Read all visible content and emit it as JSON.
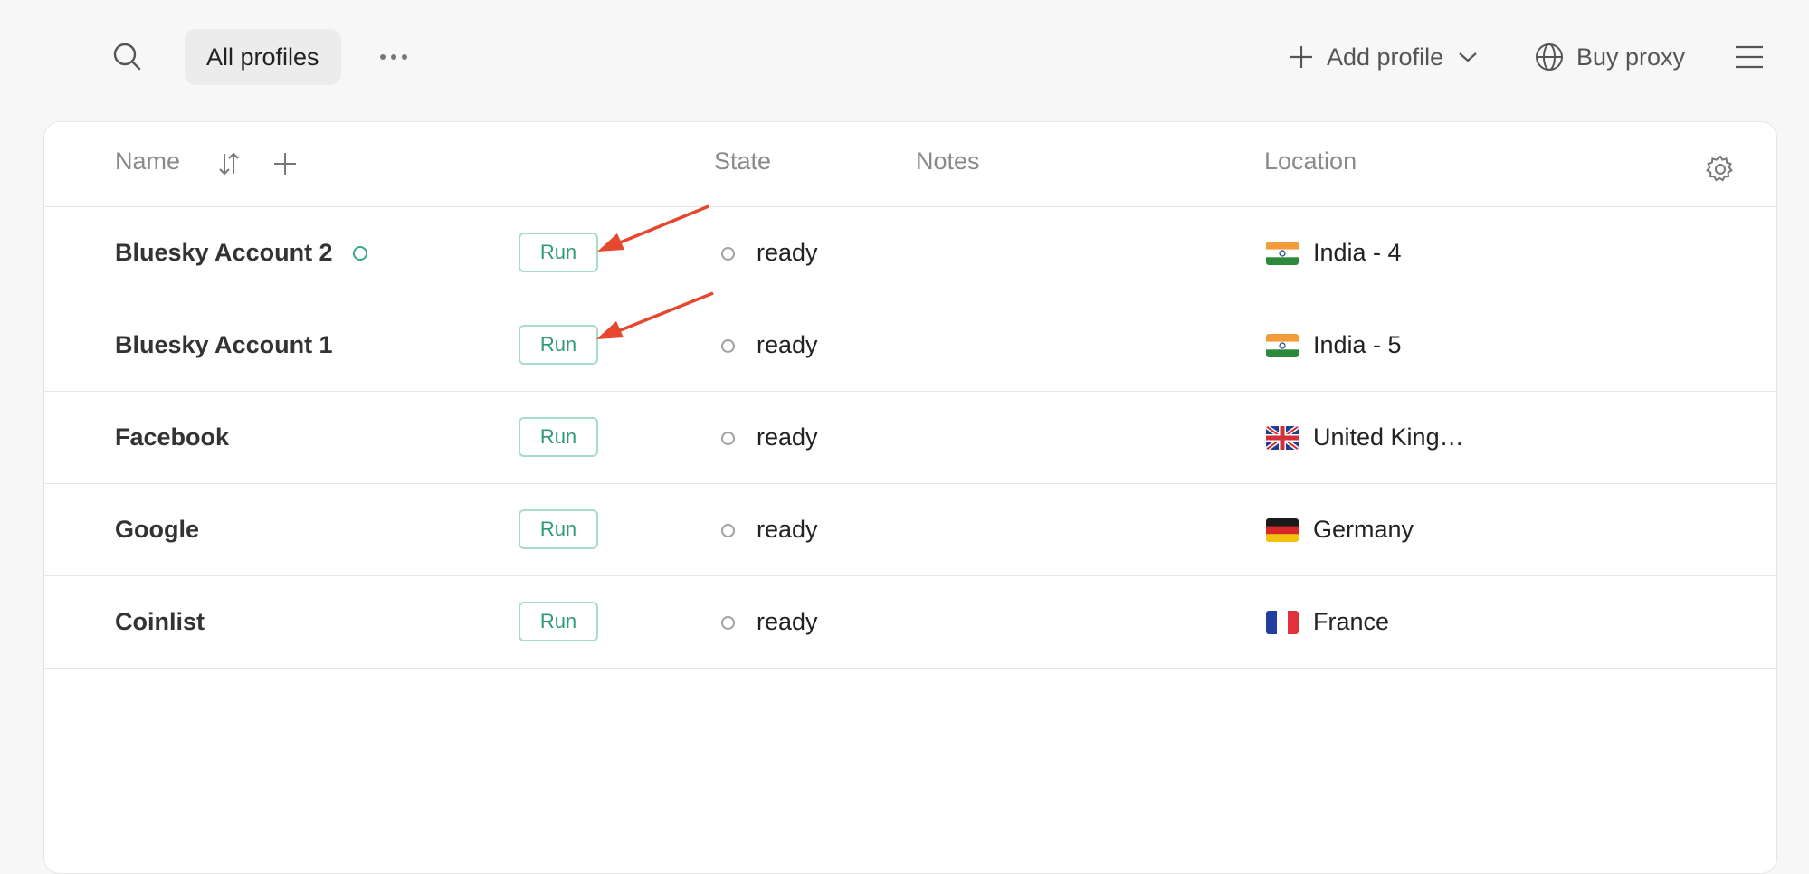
{
  "topbar": {
    "search_icon": "search-icon",
    "tab_label": "All profiles",
    "more_icon": "more-horizontal-icon",
    "add_profile_label": "Add profile",
    "buy_proxy_label": "Buy proxy",
    "menu_icon": "hamburger-menu-icon"
  },
  "table": {
    "headers": {
      "name": "Name",
      "state": "State",
      "notes": "Notes",
      "location": "Location"
    },
    "run_label": "Run",
    "rows": [
      {
        "name": "Bluesky Account 2",
        "state": "ready",
        "location": "India - 4",
        "flag": "IN"
      },
      {
        "name": "Bluesky Account 1",
        "state": "ready",
        "location": "India - 5",
        "flag": "IN"
      },
      {
        "name": "Facebook",
        "state": "ready",
        "location": "United King…",
        "flag": "GB"
      },
      {
        "name": "Google",
        "state": "ready",
        "location": "Germany",
        "flag": "DE"
      },
      {
        "name": "Coinlist",
        "state": "ready",
        "location": "France",
        "flag": "FR"
      }
    ]
  },
  "colors": {
    "accent_green": "#2e9a78",
    "annotation_arrow": "#e5482f"
  }
}
